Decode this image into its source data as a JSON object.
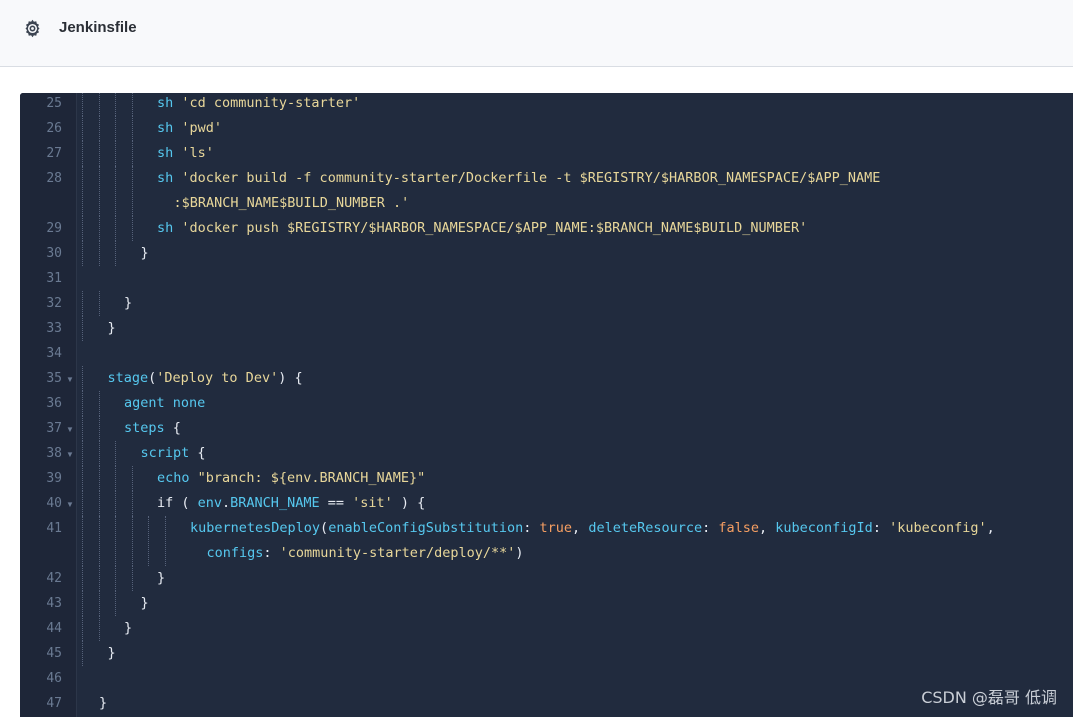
{
  "file": {
    "title": "Jenkinsfile",
    "icon": "gear-icon"
  },
  "colors": {
    "editor_bg": "#212b3e",
    "keyword": "#56c8ef",
    "string": "#e8d79a",
    "boolean": "#f59e62",
    "plain": "#e8ecf3",
    "line_number": "#6a7a92"
  },
  "code": {
    "lines": [
      {
        "n": "25",
        "indent": 4,
        "segs": [
          [
            "k",
            "sh "
          ],
          [
            "s",
            "'cd community-starter'"
          ]
        ]
      },
      {
        "n": "26",
        "indent": 4,
        "segs": [
          [
            "k",
            "sh "
          ],
          [
            "s",
            "'pwd'"
          ]
        ]
      },
      {
        "n": "27",
        "indent": 4,
        "segs": [
          [
            "k",
            "sh "
          ],
          [
            "s",
            "'ls'"
          ]
        ]
      },
      {
        "n": "28",
        "indent": 4,
        "segs": [
          [
            "k",
            "sh "
          ],
          [
            "s",
            "'docker build -f community-starter/Dockerfile -t $REGISTRY/$HARBOR_NAMESPACE/$APP_NAME"
          ]
        ],
        "wrap": {
          "indent": 5,
          "segs": [
            [
              "s",
              ":$BRANCH_NAME$BUILD_NUMBER .'"
            ]
          ]
        }
      },
      {
        "n": "29",
        "indent": 4,
        "segs": [
          [
            "k",
            "sh "
          ],
          [
            "s",
            "'docker push $REGISTRY/$HARBOR_NAMESPACE/$APP_NAME:$BRANCH_NAME$BUILD_NUMBER'"
          ]
        ]
      },
      {
        "n": "30",
        "indent": 3,
        "segs": [
          [
            "w",
            "}"
          ]
        ]
      },
      {
        "n": "31",
        "indent": 0,
        "segs": []
      },
      {
        "n": "32",
        "indent": 2,
        "segs": [
          [
            "w",
            "}"
          ]
        ]
      },
      {
        "n": "33",
        "indent": 1,
        "segs": [
          [
            "w",
            "}"
          ]
        ]
      },
      {
        "n": "34",
        "indent": 0,
        "segs": []
      },
      {
        "n": "35",
        "indent": 1,
        "fold": true,
        "segs": [
          [
            "k",
            "stage"
          ],
          [
            "w",
            "("
          ],
          [
            "s",
            "'Deploy to Dev'"
          ],
          [
            "w",
            ") {"
          ]
        ]
      },
      {
        "n": "36",
        "indent": 2,
        "segs": [
          [
            "k",
            "agent none"
          ]
        ]
      },
      {
        "n": "37",
        "indent": 2,
        "fold": true,
        "segs": [
          [
            "k",
            "steps"
          ],
          [
            "w",
            " {"
          ]
        ]
      },
      {
        "n": "38",
        "indent": 3,
        "fold": true,
        "segs": [
          [
            "k",
            "script"
          ],
          [
            "w",
            " {"
          ]
        ]
      },
      {
        "n": "39",
        "indent": 4,
        "segs": [
          [
            "k",
            "echo "
          ],
          [
            "s",
            "\"branch: ${env.BRANCH_NAME}\""
          ]
        ]
      },
      {
        "n": "40",
        "indent": 4,
        "fold": true,
        "segs": [
          [
            "w",
            "if ( "
          ],
          [
            "k",
            "env"
          ],
          [
            "w",
            "."
          ],
          [
            "k",
            "BRANCH_NAME"
          ],
          [
            "w",
            " == "
          ],
          [
            "s",
            "'sit'"
          ],
          [
            "w",
            " ) {"
          ]
        ]
      },
      {
        "n": "41",
        "indent": 6,
        "segs": [
          [
            "k",
            "kubernetesDeploy"
          ],
          [
            "w",
            "("
          ],
          [
            "k",
            "enableConfigSubstitution"
          ],
          [
            "w",
            ": "
          ],
          [
            "f",
            "true"
          ],
          [
            "w",
            ", "
          ],
          [
            "k",
            "deleteResource"
          ],
          [
            "w",
            ": "
          ],
          [
            "f",
            "false"
          ],
          [
            "w",
            ", "
          ],
          [
            "k",
            "kubeconfigId"
          ],
          [
            "w",
            ": "
          ],
          [
            "s",
            "'kubeconfig'"
          ],
          [
            "w",
            ","
          ]
        ],
        "wrap": {
          "indent": 7,
          "segs": [
            [
              "k",
              "configs"
            ],
            [
              "w",
              ": "
            ],
            [
              "s",
              "'community-starter/deploy/**'"
            ],
            [
              "w",
              ")"
            ]
          ]
        }
      },
      {
        "n": "42",
        "indent": 4,
        "segs": [
          [
            "w",
            "}"
          ]
        ]
      },
      {
        "n": "43",
        "indent": 3,
        "segs": [
          [
            "w",
            "}"
          ]
        ]
      },
      {
        "n": "44",
        "indent": 2,
        "segs": [
          [
            "w",
            "}"
          ]
        ]
      },
      {
        "n": "45",
        "indent": 1,
        "segs": [
          [
            "w",
            "}"
          ]
        ]
      },
      {
        "n": "46",
        "indent": 0,
        "segs": []
      },
      {
        "n": "47",
        "indent": 0,
        "segs": [
          [
            "w",
            "}"
          ]
        ]
      }
    ]
  },
  "watermark": "CSDN @磊哥 低调"
}
